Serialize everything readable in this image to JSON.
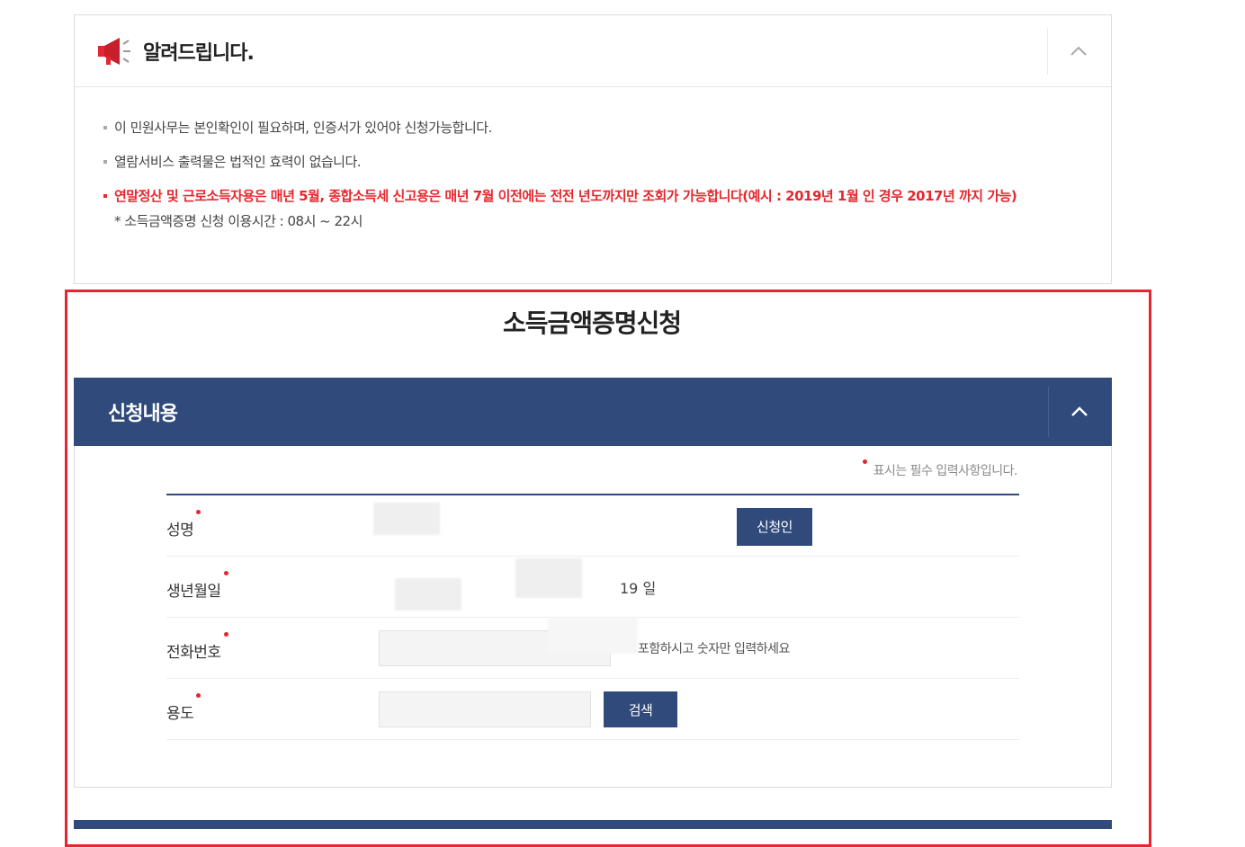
{
  "notice": {
    "title": "알려드립니다.",
    "icon": "megaphone-icon",
    "toggle_icon": "chevron-up-icon",
    "lines": [
      "이 민원사무는 본인확인이 필요하며, 인증서가 있어야 신청가능합니다.",
      "열람서비스 출력물은 법적인 효력이 없습니다.",
      "연말정산 및 근로소득자용은 매년 5월, 종합소득세 신고용은 매년 7월 이전에는 전전 년도까지만 조회가 가능합니다(예시 : 2019년 1월 인 경우 2017년 까지 가능)"
    ],
    "sub_note": "* 소득금액증명 신청 이용시간 : 08시 ~ 22시"
  },
  "form": {
    "title": "소득금액증명신청",
    "section_title": "신청내용",
    "toggle_icon": "chevron-up-icon",
    "required_note": "표시는 필수 입력사항입니다.",
    "rows": {
      "name": {
        "label": "성명",
        "button": "신청인"
      },
      "birth": {
        "label": "생년월일",
        "day_text": "19 일"
      },
      "phone": {
        "label": "전화번호",
        "hint": "포함하시고 숫자만 입력하세요"
      },
      "purpose": {
        "label": "용도",
        "button": "검색"
      }
    }
  },
  "colors": {
    "primary": "#2f4a7b",
    "highlight": "#e3262f",
    "notice_red": "#e8262c"
  }
}
